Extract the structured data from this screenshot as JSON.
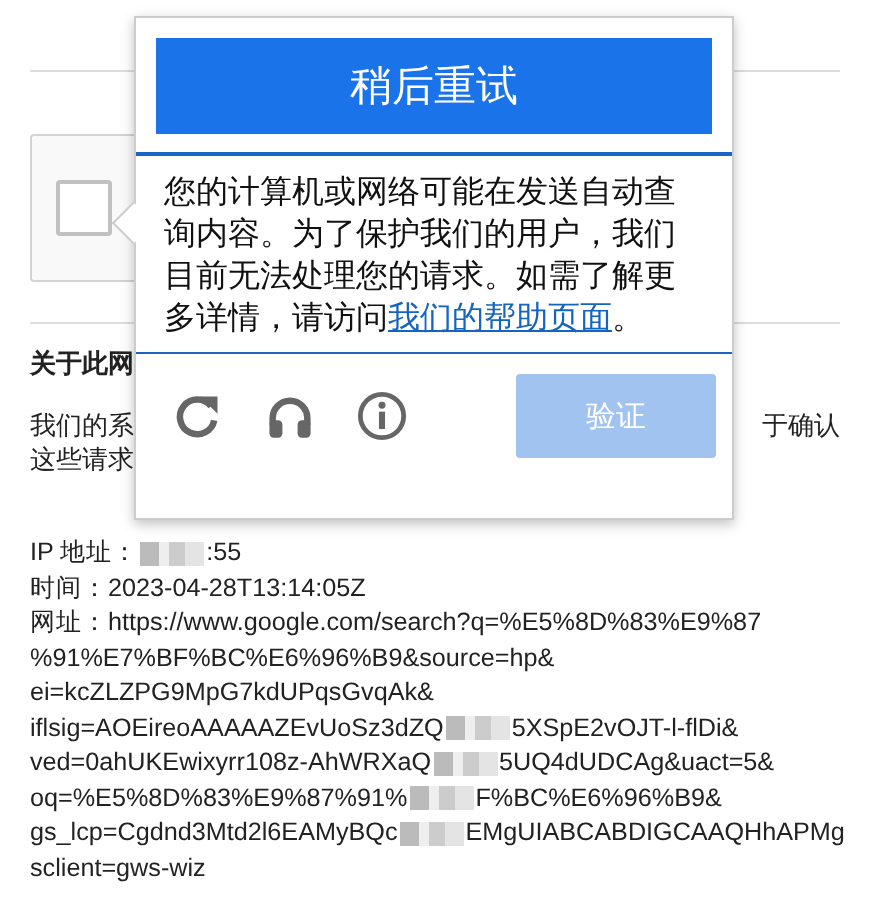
{
  "page": {
    "section_title": "关于此网",
    "body_left": [
      "我们的系",
      "这些请求"
    ],
    "body_right": "于确认",
    "details": [
      {
        "parts": [
          {
            "text": "IP 地址："
          },
          {
            "redacted": true
          },
          {
            "text": ":55"
          }
        ]
      },
      {
        "parts": [
          {
            "text": "时间：2023-04-28T13:14:05Z"
          }
        ]
      },
      {
        "parts": [
          {
            "text": "网址：https://www.google.com/search?q=%E5%8D%83%E9%87"
          }
        ]
      },
      {
        "parts": [
          {
            "text": "%91%E7%BF%BC%E6%96%B9&source=hp&"
          }
        ]
      },
      {
        "parts": [
          {
            "text": "ei=kcZLZPG9MpG7kdUPqsGvqAk&"
          }
        ]
      },
      {
        "parts": [
          {
            "text": "iflsig=AOEireoAAAAAZEvUoSz3dZQ"
          },
          {
            "redacted": true
          },
          {
            "text": "5XSpE2vOJT-l-flDi&"
          }
        ]
      },
      {
        "parts": [
          {
            "text": "ved=0ahUKEwixyrr108z-AhWRXaQ"
          },
          {
            "redacted": true
          },
          {
            "text": "5UQ4dUDCAg&uact=5&"
          }
        ]
      },
      {
        "parts": [
          {
            "text": "oq=%E5%8D%83%E9%87%91%"
          },
          {
            "redacted": true
          },
          {
            "text": "F%BC%E6%96%B9&"
          }
        ]
      },
      {
        "parts": [
          {
            "text": "gs_lcp=Cgdnd3Mtd2l6EAMyBQc"
          },
          {
            "redacted": true
          },
          {
            "text": "EMgUIABCABDIGCAAQHhAPMg"
          }
        ]
      },
      {
        "parts": [
          {
            "text": "sclient=gws-wiz"
          }
        ]
      }
    ]
  },
  "recaptcha": {
    "checked": false
  },
  "challenge": {
    "header": "稍后重试",
    "message": "您的计算机或网络可能在发送自动查询内容。为了保护我们的用户，我们目前无法处理您的请求。如需了解更多详情，请访问",
    "link": "我们的帮助页面",
    "message_end": "。",
    "verify_button": {
      "label": "验证",
      "disabled": true
    }
  }
}
